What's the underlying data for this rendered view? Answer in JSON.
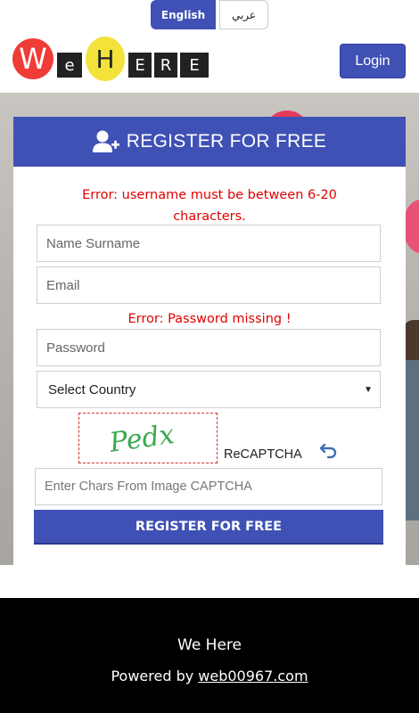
{
  "lang": {
    "english": "English",
    "arabic": "عربي"
  },
  "logo": {
    "letters": [
      "W",
      "e",
      "H",
      "E",
      "R",
      "E"
    ]
  },
  "header": {
    "login_label": "Login"
  },
  "panel": {
    "title": "REGISTER FOR FREE",
    "errors": {
      "username": "Error: username must be between 6-20 characters.",
      "password": "Error: Password missing !"
    },
    "fields": {
      "name_placeholder": "Name Surname",
      "email_placeholder": "Email",
      "password_placeholder": "Password",
      "country_selected": "Select Country",
      "captcha_placeholder": "Enter Chars From Image CAPTCHA"
    },
    "captcha_text": "Pedx",
    "recaptcha_label": "ReCAPTCHA",
    "submit_label": "REGISTER FOR FREE"
  },
  "footer": {
    "title": "We Here",
    "powered_prefix": "Powered by ",
    "powered_link": "web00967.com"
  },
  "colors": {
    "primary": "#3f51b5",
    "error": "#e00000",
    "footer_bg": "#000000"
  },
  "icons": {
    "user_add": "user-plus-icon",
    "refresh": "refresh-icon",
    "caret": "caret-down-icon"
  }
}
